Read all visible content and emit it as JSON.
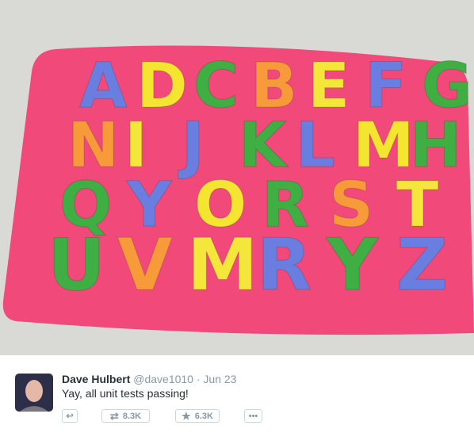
{
  "photo": {
    "rows": [
      [
        "A",
        "D",
        "C",
        "B",
        "E",
        "F",
        "G"
      ],
      [
        "N",
        "I",
        "J",
        "K",
        "L",
        "M",
        "H"
      ],
      [
        "Q",
        "Y",
        "O",
        "R",
        "S",
        "T"
      ],
      [
        "U",
        "V",
        "M",
        "R",
        "Y",
        "Z"
      ]
    ],
    "colors": {
      "mat": "#f0497a",
      "background": "#d9dad6",
      "letters": [
        "#6a7ee0",
        "#f4e531",
        "#3fae43",
        "#f69a3a",
        "#f5e63b",
        "#6a7ee0",
        "#3fae43"
      ]
    }
  },
  "tweet": {
    "name": "Dave Hulbert",
    "handle": "@dave1010",
    "separator": "·",
    "date": "Jun 23",
    "text": "Yay, all unit tests passing!",
    "retweets": "8.3K",
    "favorites": "6.3K"
  }
}
